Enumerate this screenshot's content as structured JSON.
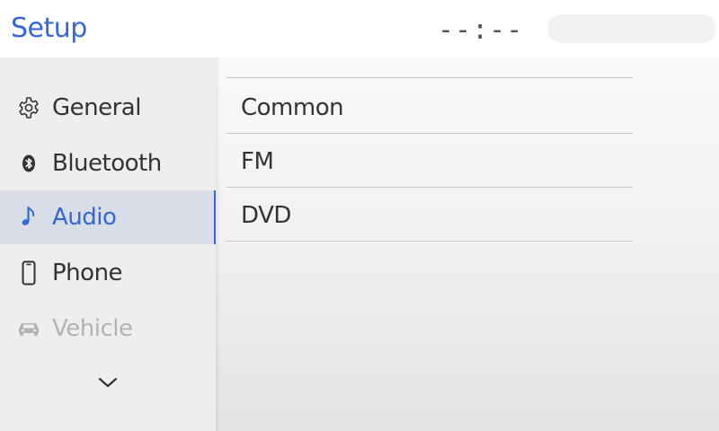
{
  "header": {
    "title": "Setup",
    "clock": "--:--"
  },
  "sidebar": {
    "items": [
      {
        "label": "General",
        "icon": "gear-icon",
        "state": "normal"
      },
      {
        "label": "Bluetooth",
        "icon": "bluetooth-icon",
        "state": "normal"
      },
      {
        "label": "Audio",
        "icon": "music-note-icon",
        "state": "active"
      },
      {
        "label": "Phone",
        "icon": "phone-icon",
        "state": "normal"
      },
      {
        "label": "Vehicle",
        "icon": "car-icon",
        "state": "disabled"
      }
    ],
    "more_icon": "chevron-down-icon"
  },
  "content": {
    "rows": [
      {
        "label": "Common"
      },
      {
        "label": "FM"
      },
      {
        "label": "DVD"
      }
    ]
  },
  "colors": {
    "accent": "#3468d6",
    "text": "#333333",
    "disabled_text": "#b3b3b3",
    "sidebar_bg": "#eeeef0",
    "active_bg": "#d8dde8"
  }
}
